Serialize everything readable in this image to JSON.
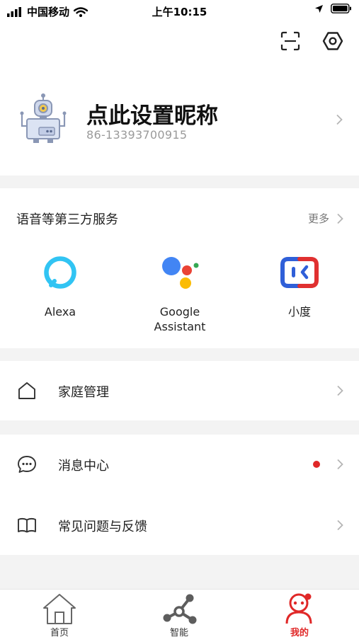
{
  "status_bar": {
    "carrier": "中国移动",
    "time": "上午10:15"
  },
  "profile": {
    "nickname": "点此设置昵称",
    "phone": "86-13393700915"
  },
  "services": {
    "title": "语音等第三方服务",
    "more_label": "更多",
    "items": [
      {
        "label": "Alexa",
        "icon": "alexa-icon"
      },
      {
        "label": "Google\nAssistant",
        "icon": "google-assistant-icon"
      },
      {
        "label": "小度",
        "icon": "xiaodu-icon"
      }
    ]
  },
  "menu": {
    "home_management": "家庭管理",
    "message_center": "消息中心",
    "faq_feedback": "常见问题与反馈"
  },
  "tabbar": {
    "home": "首页",
    "smart": "智能",
    "mine": "我的",
    "active": "mine"
  },
  "colors": {
    "accent": "#e02828",
    "alexa": "#31c4f3",
    "google_blue": "#4285f4",
    "google_red": "#ea4335",
    "google_yellow": "#fbbc05",
    "google_green": "#34a853",
    "xiaodu_blue": "#2f5fd8",
    "xiaodu_red": "#e03030"
  }
}
